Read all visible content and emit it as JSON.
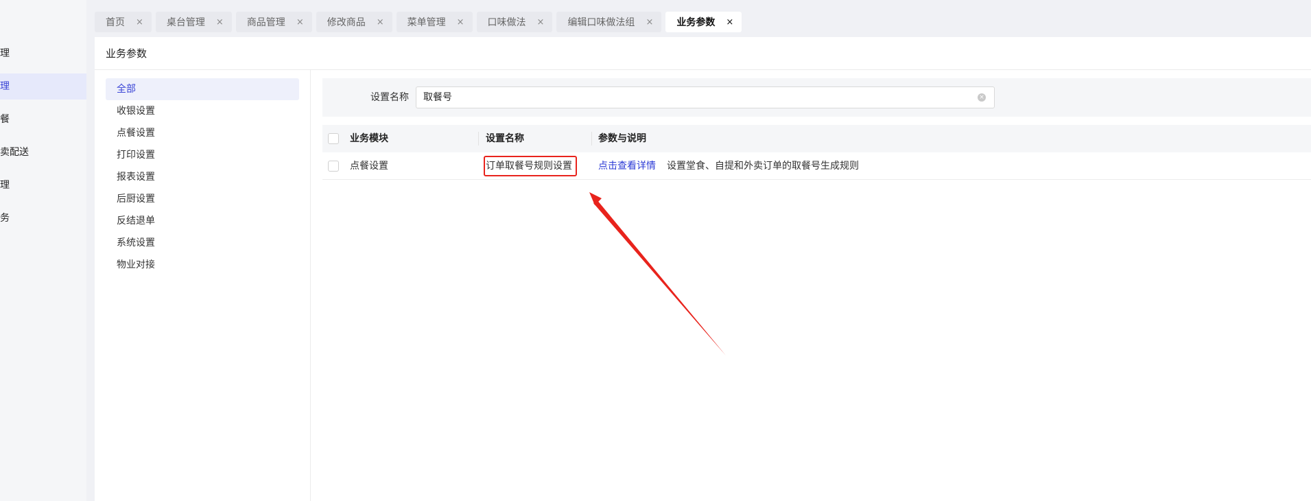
{
  "sidebar": {
    "items": [
      {
        "label": "管理",
        "active": false
      },
      {
        "label": "管理",
        "active": true
      },
      {
        "label": "点餐",
        "active": false
      },
      {
        "label": "外卖配送",
        "active": false
      },
      {
        "label": "管理",
        "active": false
      },
      {
        "label": "服务",
        "active": false
      }
    ]
  },
  "tabs": [
    {
      "label": "首页",
      "active": false
    },
    {
      "label": "桌台管理",
      "active": false
    },
    {
      "label": "商品管理",
      "active": false
    },
    {
      "label": "修改商品",
      "active": false
    },
    {
      "label": "菜单管理",
      "active": false
    },
    {
      "label": "口味做法",
      "active": false
    },
    {
      "label": "编辑口味做法组",
      "active": false
    },
    {
      "label": "业务参数",
      "active": true
    }
  ],
  "tab_close_glyph": "×",
  "page": {
    "title": "业务参数"
  },
  "categories": [
    {
      "label": "全部",
      "active": true
    },
    {
      "label": "收银设置",
      "active": false
    },
    {
      "label": "点餐设置",
      "active": false
    },
    {
      "label": "打印设置",
      "active": false
    },
    {
      "label": "报表设置",
      "active": false
    },
    {
      "label": "后厨设置",
      "active": false
    },
    {
      "label": "反结退单",
      "active": false
    },
    {
      "label": "系统设置",
      "active": false
    },
    {
      "label": "物业对接",
      "active": false
    }
  ],
  "filter": {
    "label": "设置名称",
    "value": "取餐号",
    "clear_icon": "×"
  },
  "table": {
    "headers": {
      "module": "业务模块",
      "name": "设置名称",
      "params": "参数与说明"
    },
    "rows": [
      {
        "module": "点餐设置",
        "name": "订单取餐号规则设置",
        "link": "点击查看详情",
        "desc": "设置堂食、自提和外卖订单的取餐号生成规则"
      }
    ]
  },
  "colors": {
    "accent": "#3a45d6",
    "link": "#2b3ad6",
    "annotation_red": "#e8231c"
  }
}
